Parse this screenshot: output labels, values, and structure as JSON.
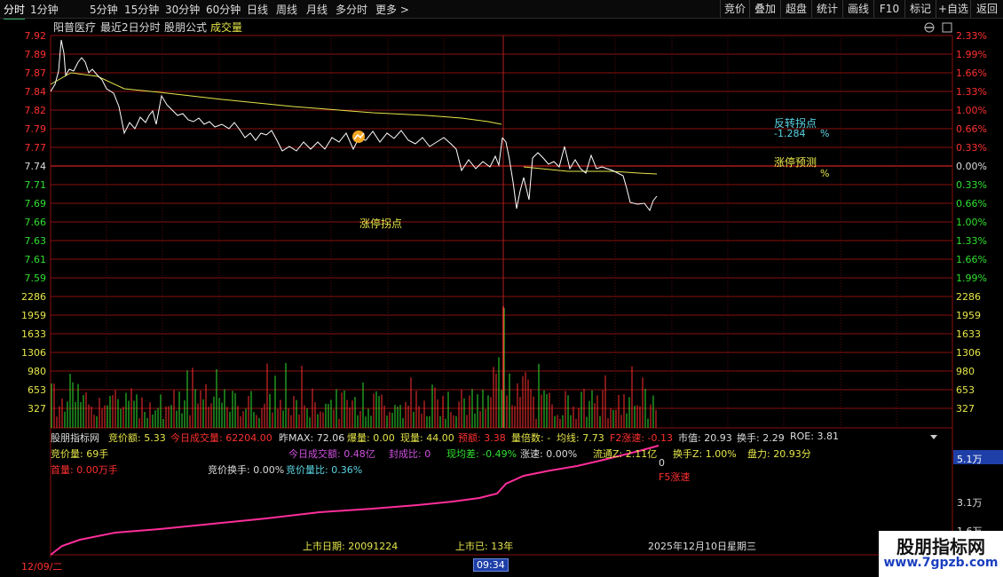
{
  "toolbar": {
    "timeframes": [
      "分时",
      "1分钟",
      "5分钟",
      "15分钟",
      "30分钟",
      "60分钟",
      "日线",
      "周线",
      "月线",
      "多分时",
      "更多 >"
    ],
    "right_buttons": [
      "竞价",
      "叠加",
      "超盘",
      "统计",
      "画线",
      "F10",
      "标记",
      "+自选",
      "返回"
    ]
  },
  "chart_header": {
    "stock_name": "阳普医疗",
    "period": "最近2日分时",
    "formula": "股朋公式",
    "volume_label": "成交量"
  },
  "price_axis": {
    "left_ticks": [
      "7.92",
      "7.89",
      "7.87",
      "7.84",
      "7.82",
      "7.79",
      "7.77",
      "7.74",
      "7.71",
      "7.69",
      "7.66",
      "7.63",
      "7.61",
      "7.59"
    ],
    "right_ticks": [
      "2.33%",
      "1.99%",
      "1.66%",
      "1.33%",
      "1.00%",
      "0.66%",
      "0.33%",
      "0.00%",
      "0.33%",
      "0.66%",
      "1.00%",
      "1.33%",
      "1.66%",
      "1.99%"
    ],
    "prev_close": 7.74
  },
  "volume_axis": {
    "ticks": [
      "2286",
      "1959",
      "1633",
      "1306",
      "980",
      "653",
      "327"
    ]
  },
  "annotations": {
    "reversal_point_label": "反转拐点",
    "reversal_point_value": "-1.284",
    "reversal_point_unit": "%",
    "limit_forecast_label": "涨停预测",
    "limit_forecast_unit": "%",
    "limit_turn_label": "涨停拐点"
  },
  "indicator_panel": {
    "row1": {
      "name": "股朋指标网",
      "auction_amount": "竞价额: 5.33",
      "today_volume": "今日成交量: 62204.00",
      "prev_max": "昨MAX: 72.06",
      "explode": "爆量: 0.00",
      "current_vol": "现量: 44.00",
      "forecast": "预额: 3.38",
      "vol_ratio": "量倍数: -",
      "avg_line": "均线: 7.73",
      "f2_speed": "F2涨速: -0.13",
      "market_cap": "市值: 20.93",
      "turnover": "换手: 2.29",
      "roe": "ROE: 3.81"
    },
    "row2": {
      "auction_qty": "竞价量: 69手",
      "today_amount": "今日成交额: 0.48亿",
      "open_ratio": "封成比: 0",
      "now_avg_diff": "现均差: -0.49%",
      "speed": "涨速: 0.00%",
      "float": "流通Z: 2.11亿",
      "turnover_z": "换手Z: 1.00%",
      "disk": "盘力: 20.93分"
    },
    "row3": {
      "first_qty": "首量: 0.00万手",
      "auction_turnover": "竞价换手: 0.00%",
      "auction_qty_ratio": "竞价量比: 0.36%"
    },
    "zero_value": "0",
    "f5_label": "F5涨速",
    "right_scale": [
      "5.1万",
      "3.1万",
      "1.6万"
    ],
    "listing_date": "上市日期: 20091224",
    "listed_years": "上市已: 13年",
    "current_date": "2025年12月10日星期三"
  },
  "timeline": {
    "left_date": "12/09/二",
    "cursor_time": "09:34"
  },
  "logo": {
    "title": "股朋指标网",
    "url": "www.7gpzb.com"
  },
  "colors": {
    "up": "#ff3030",
    "down": "#30e030",
    "price_line": "#ffffff",
    "avg_line": "#e6e64a",
    "cumulative_line": "#ff2e9a",
    "grid": "#8a1010"
  }
}
